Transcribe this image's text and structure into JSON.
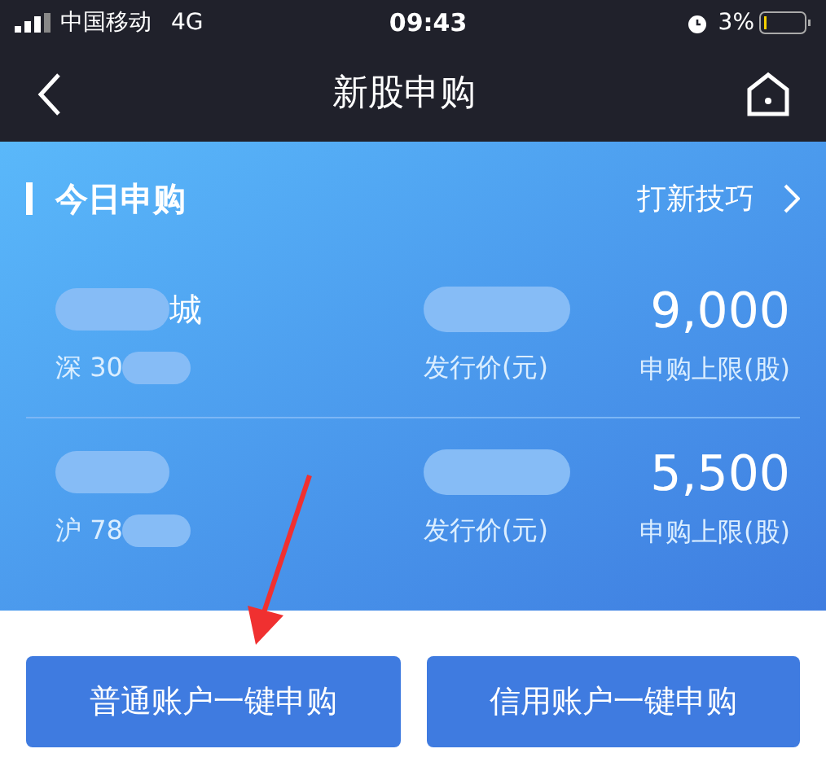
{
  "status_bar": {
    "carrier": "中国移动",
    "network": "4G",
    "time": "09:43",
    "battery": "3%"
  },
  "nav": {
    "title": "新股申购"
  },
  "section": {
    "title": "今日申购",
    "link": "打新技巧"
  },
  "rows": [
    {
      "name_tail": "城",
      "code": "深 30",
      "price_label": "发行价(元)",
      "limit": "9,000",
      "limit_label": "申购上限(股)"
    },
    {
      "code": "沪 78",
      "price_label": "发行价(元)",
      "limit": "5,500",
      "limit_label": "申购上限(股)"
    }
  ],
  "buttons": [
    "普通账户一键申购",
    "信用账户一键申购"
  ]
}
